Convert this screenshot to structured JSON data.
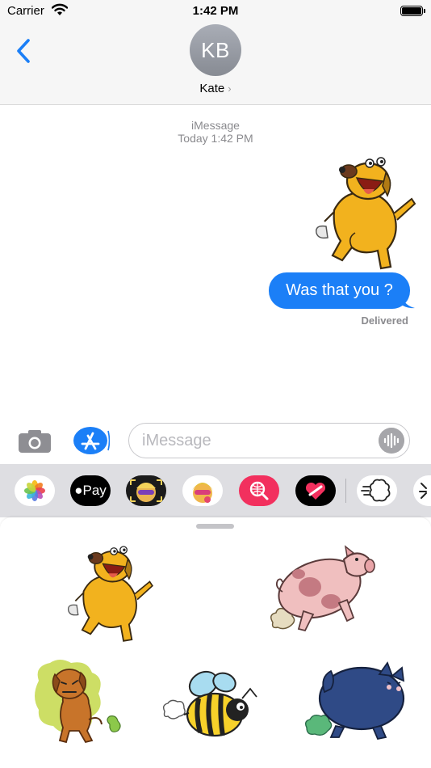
{
  "status_bar": {
    "carrier": "Carrier",
    "time": "1:42 PM"
  },
  "header": {
    "avatar_initials": "KB",
    "contact_name": "Kate",
    "contact_chevron": "›"
  },
  "conversation": {
    "service": "iMessage",
    "timestamp": "Today 1:42 PM",
    "sent_sticker": "dog-sticker",
    "message_text": "Was that you ?",
    "delivery_status": "Delivered"
  },
  "compose": {
    "placeholder": "iMessage"
  },
  "app_strip": {
    "apps": [
      "photos",
      "apple-pay",
      "memoji",
      "animoji",
      "web-images-search",
      "digital-touch",
      "fart-sticker-app",
      "next-app"
    ],
    "apple_pay_label": "Pay"
  },
  "sticker_drawer": {
    "stickers": [
      "dog-sticker",
      "pig-sticker",
      "puppy-sticker",
      "bee-sticker",
      "cat-sticker"
    ]
  },
  "colors": {
    "accent": "#1b7ff7",
    "bubble": "#1b7ff7",
    "header_bg": "#f6f6f6",
    "strip_bg": "#dedee2"
  }
}
